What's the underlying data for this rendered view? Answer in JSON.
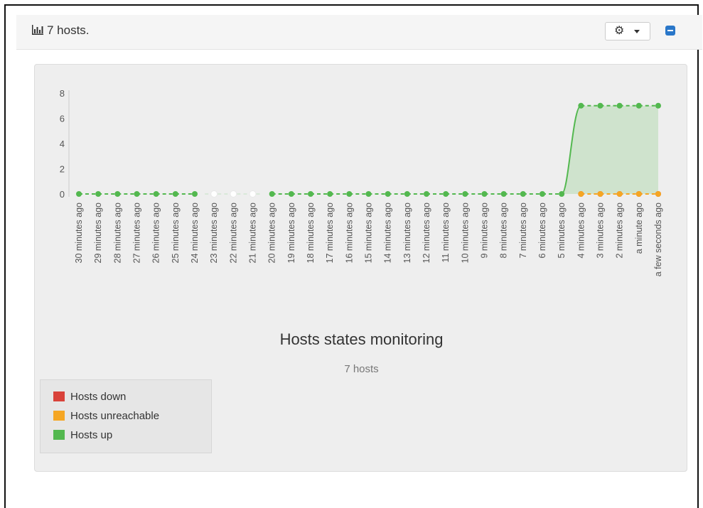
{
  "header": {
    "title": "7 hosts.",
    "chart_icon": "bar-chart-icon",
    "settings_icon": "gear-icon",
    "collapse_icon": "minus-icon"
  },
  "colors": {
    "hosts_down": "#d9423a",
    "hosts_unreachable": "#f5a623",
    "hosts_up": "#53b84f",
    "area_fill": "#cfe3cd"
  },
  "legend": {
    "items": [
      {
        "label": "Hosts down",
        "color": "#d9423a"
      },
      {
        "label": "Hosts unreachable",
        "color": "#f5a623"
      },
      {
        "label": "Hosts up",
        "color": "#53b84f"
      }
    ]
  },
  "chart_data": {
    "type": "area",
    "title": "Hosts states monitoring",
    "subtitle": "7 hosts",
    "categories": [
      "30 minutes ago",
      "29 minutes ago",
      "28 minutes ago",
      "27 minutes ago",
      "26 minutes ago",
      "25 minutes ago",
      "24 minutes ago",
      "23 minutes ago",
      "22 minutes ago",
      "21 minutes ago",
      "20 minutes ago",
      "19 minutes ago",
      "18 minutes ago",
      "17 minutes ago",
      "16 minutes ago",
      "15 minutes ago",
      "14 minutes ago",
      "13 minutes ago",
      "12 minutes ago",
      "11 minutes ago",
      "10 minutes ago",
      "9 minutes ago",
      "8 minutes ago",
      "7 minutes ago",
      "6 minutes ago",
      "5 minutes ago",
      "4 minutes ago",
      "3 minutes ago",
      "2 minutes ago",
      "a minute ago",
      "a few seconds ago"
    ],
    "yticks": [
      0,
      2,
      4,
      6,
      8
    ],
    "ylim": [
      0,
      8
    ],
    "grid": false,
    "legend_position": "bottom-left",
    "series": [
      {
        "name": "Hosts down",
        "values": [
          null,
          null,
          null,
          null,
          null,
          null,
          null,
          null,
          null,
          null,
          null,
          null,
          null,
          null,
          null,
          null,
          null,
          null,
          null,
          null,
          null,
          null,
          null,
          null,
          null,
          null,
          0,
          0,
          0,
          0,
          0
        ]
      },
      {
        "name": "Hosts unreachable",
        "values": [
          null,
          null,
          null,
          null,
          null,
          null,
          null,
          null,
          null,
          null,
          null,
          null,
          null,
          null,
          null,
          null,
          null,
          null,
          null,
          null,
          null,
          null,
          null,
          null,
          null,
          null,
          0,
          0,
          0,
          0,
          0
        ]
      },
      {
        "name": "Hosts up",
        "values": [
          0,
          0,
          0,
          0,
          0,
          0,
          0,
          null,
          null,
          null,
          0,
          0,
          0,
          0,
          0,
          0,
          0,
          0,
          0,
          0,
          0,
          0,
          0,
          0,
          0,
          0,
          7,
          7,
          7,
          7,
          7
        ]
      }
    ]
  }
}
